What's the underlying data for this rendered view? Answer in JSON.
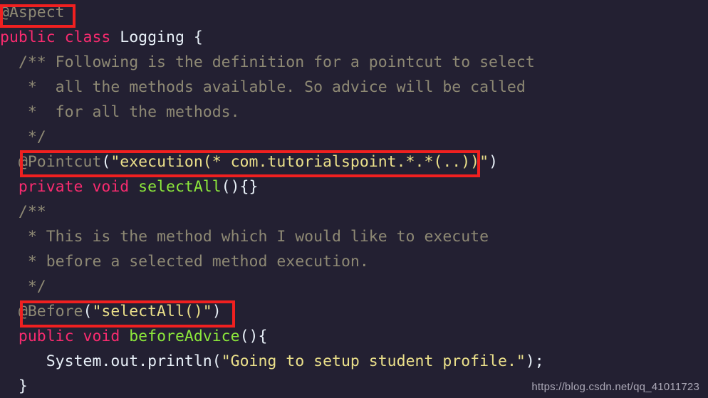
{
  "editor": {
    "background_color": "#232032",
    "language": "java",
    "font_size_px": 21.5,
    "line_height_px": 35,
    "colors": {
      "keyword": "#f92b6f",
      "type": "#e8f0f8",
      "function": "#8ce83b",
      "string": "#ebe08a",
      "comment": "#8e8974",
      "annotation": "#8e8974",
      "punctuation": "#e8f0f8",
      "highlight_box": "#f02020"
    },
    "lines": [
      {
        "id": "line-1",
        "indent": "",
        "tokens": [
          {
            "text": "@Aspect",
            "cls": "anno"
          }
        ]
      },
      {
        "id": "line-2",
        "indent": "",
        "tokens": [
          {
            "text": "public class ",
            "cls": "kw"
          },
          {
            "text": "Logging",
            "cls": "typ"
          },
          {
            "text": " {",
            "cls": "punct"
          }
        ]
      },
      {
        "id": "line-3",
        "indent": "  ",
        "tokens": [
          {
            "text": "/** Following is the definition for a pointcut to select",
            "cls": "cmt"
          }
        ]
      },
      {
        "id": "line-4",
        "indent": "   ",
        "tokens": [
          {
            "text": "*  all the methods available. So advice will be called",
            "cls": "cmt"
          }
        ]
      },
      {
        "id": "line-5",
        "indent": "   ",
        "tokens": [
          {
            "text": "*  for all the methods.",
            "cls": "cmt"
          }
        ]
      },
      {
        "id": "line-6",
        "indent": "   ",
        "tokens": [
          {
            "text": "*/",
            "cls": "cmt"
          }
        ]
      },
      {
        "id": "line-7",
        "indent": "  ",
        "tokens": [
          {
            "text": "@Pointcut",
            "cls": "anno"
          },
          {
            "text": "(",
            "cls": "punct"
          },
          {
            "text": "\"execution(* com.tutorialspoint.*.*(..))\"",
            "cls": "str"
          },
          {
            "text": ")",
            "cls": "punct"
          }
        ]
      },
      {
        "id": "line-8",
        "indent": "  ",
        "tokens": [
          {
            "text": "private void ",
            "cls": "kw"
          },
          {
            "text": "selectAll",
            "cls": "fn"
          },
          {
            "text": "(){}",
            "cls": "punct"
          }
        ]
      },
      {
        "id": "line-9",
        "indent": "  ",
        "tokens": [
          {
            "text": "/**",
            "cls": "cmt"
          }
        ]
      },
      {
        "id": "line-10",
        "indent": "   ",
        "tokens": [
          {
            "text": "* This is the method which I would like to execute",
            "cls": "cmt"
          }
        ]
      },
      {
        "id": "line-11",
        "indent": "   ",
        "tokens": [
          {
            "text": "* before a selected method execution.",
            "cls": "cmt"
          }
        ]
      },
      {
        "id": "line-12",
        "indent": "   ",
        "tokens": [
          {
            "text": "*/",
            "cls": "cmt"
          }
        ]
      },
      {
        "id": "line-13",
        "indent": "  ",
        "tokens": [
          {
            "text": "@Before",
            "cls": "anno"
          },
          {
            "text": "(",
            "cls": "punct"
          },
          {
            "text": "\"selectAll()\"",
            "cls": "str"
          },
          {
            "text": ")",
            "cls": "punct"
          }
        ]
      },
      {
        "id": "line-14",
        "indent": "  ",
        "tokens": [
          {
            "text": "public void ",
            "cls": "kw"
          },
          {
            "text": "beforeAdvice",
            "cls": "fn"
          },
          {
            "text": "(){",
            "cls": "punct"
          }
        ]
      },
      {
        "id": "line-15",
        "indent": "     ",
        "tokens": [
          {
            "text": "System.out.println",
            "cls": "plain"
          },
          {
            "text": "(",
            "cls": "punct"
          },
          {
            "text": "\"Going to setup student profile.\"",
            "cls": "str"
          },
          {
            "text": ");",
            "cls": "punct"
          }
        ]
      },
      {
        "id": "line-16",
        "indent": "  ",
        "tokens": [
          {
            "text": "}",
            "cls": "punct"
          }
        ]
      }
    ]
  },
  "annotations": {
    "boxes": [
      {
        "id": "box-aspect",
        "label": "aspect-annotation-highlight",
        "target_text": "@Aspect"
      },
      {
        "id": "box-pointcut",
        "label": "pointcut-annotation-highlight",
        "target_text": "@Pointcut(\"execution(* com.tutorialspoint.*.*(..))\")"
      },
      {
        "id": "box-before",
        "label": "before-annotation-highlight",
        "target_text": "@Before(\"selectAll()\")"
      }
    ]
  },
  "watermark": {
    "text": "https://blog.csdn.net/qq_41011723"
  }
}
